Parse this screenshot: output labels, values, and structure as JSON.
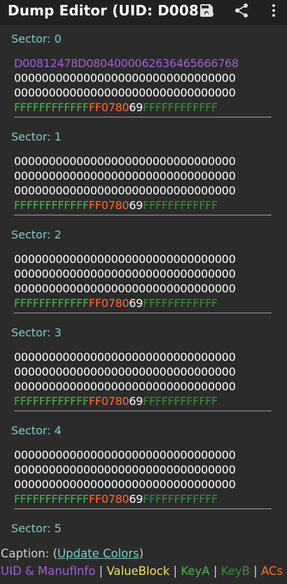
{
  "appbar": {
    "title": "Dump Editor (UID: D008...",
    "actions": [
      {
        "name": "save-icon"
      },
      {
        "name": "share-icon"
      },
      {
        "name": "more-vert-icon"
      }
    ]
  },
  "sectors": [
    {
      "title": "Sector: 0",
      "rows": [
        [
          {
            "t": "D00812478D080400006263646566676 8",
            "c": "uid"
          }
        ],
        [
          {
            "t": "00000000000000000000000000000000",
            "c": "data"
          }
        ],
        [
          {
            "t": "00000000000000000000000000000000",
            "c": "data"
          }
        ],
        [
          {
            "t": "FFFFFFFFFFFF",
            "c": "keya"
          },
          {
            "t": "FF0780",
            "c": "acs"
          },
          {
            "t": "69",
            "c": "gpb"
          },
          {
            "t": "FFFFFFFFFFFF",
            "c": "keyb"
          }
        ]
      ]
    },
    {
      "title": "Sector: 1",
      "rows": [
        [
          {
            "t": "00000000000000000000000000000000",
            "c": "data"
          }
        ],
        [
          {
            "t": "00000000000000000000000000000000",
            "c": "data"
          }
        ],
        [
          {
            "t": "00000000000000000000000000000000",
            "c": "data"
          }
        ],
        [
          {
            "t": "FFFFFFFFFFFF",
            "c": "keya"
          },
          {
            "t": "FF0780",
            "c": "acs"
          },
          {
            "t": "69",
            "c": "gpb"
          },
          {
            "t": "FFFFFFFFFFFF",
            "c": "keyb"
          }
        ]
      ]
    },
    {
      "title": "Sector: 2",
      "rows": [
        [
          {
            "t": "00000000000000000000000000000000",
            "c": "data"
          }
        ],
        [
          {
            "t": "00000000000000000000000000000000",
            "c": "data"
          }
        ],
        [
          {
            "t": "00000000000000000000000000000000",
            "c": "data"
          }
        ],
        [
          {
            "t": "FFFFFFFFFFFF",
            "c": "keya"
          },
          {
            "t": "FF0780",
            "c": "acs"
          },
          {
            "t": "69",
            "c": "gpb"
          },
          {
            "t": "FFFFFFFFFFFF",
            "c": "keyb"
          }
        ]
      ]
    },
    {
      "title": "Sector: 3",
      "rows": [
        [
          {
            "t": "00000000000000000000000000000000",
            "c": "data"
          }
        ],
        [
          {
            "t": "00000000000000000000000000000000",
            "c": "data"
          }
        ],
        [
          {
            "t": "00000000000000000000000000000000",
            "c": "data"
          }
        ],
        [
          {
            "t": "FFFFFFFFFFFF",
            "c": "keya"
          },
          {
            "t": "FF0780",
            "c": "acs"
          },
          {
            "t": "69",
            "c": "gpb"
          },
          {
            "t": "FFFFFFFFFFFF",
            "c": "keyb"
          }
        ]
      ]
    },
    {
      "title": "Sector: 4",
      "rows": [
        [
          {
            "t": "00000000000000000000000000000000",
            "c": "data"
          }
        ],
        [
          {
            "t": "00000000000000000000000000000000",
            "c": "data"
          }
        ],
        [
          {
            "t": "00000000000000000000000000000000",
            "c": "data"
          }
        ],
        [
          {
            "t": "FFFFFFFFFFFF",
            "c": "keya"
          },
          {
            "t": "FF0780",
            "c": "acs"
          },
          {
            "t": "69",
            "c": "gpb"
          },
          {
            "t": "FFFFFFFFFFFF",
            "c": "keyb"
          }
        ]
      ]
    },
    {
      "title": "Sector: 5",
      "rows": []
    }
  ],
  "caption": {
    "prefix": "Caption: (",
    "link": "Update Colors",
    "suffix": ")"
  },
  "legend": [
    {
      "label": "UID & ManufInfo",
      "c": "uid"
    },
    {
      "label": "ValueBlock",
      "c": "value"
    },
    {
      "label": "KeyA",
      "c": "keya"
    },
    {
      "label": "KeyB",
      "c": "keyb"
    },
    {
      "label": "ACs",
      "c": "acs"
    }
  ],
  "legend_separator": " | ",
  "colors": {
    "appbar_bg": "#212121",
    "background": "#2b2b2b",
    "sector_title": "#80cbc4",
    "uid": "#a55cd6",
    "value_block": "#f0e15a",
    "key_a": "#4caf50",
    "key_b": "#388e3c",
    "acs": "#ff6b2b"
  }
}
